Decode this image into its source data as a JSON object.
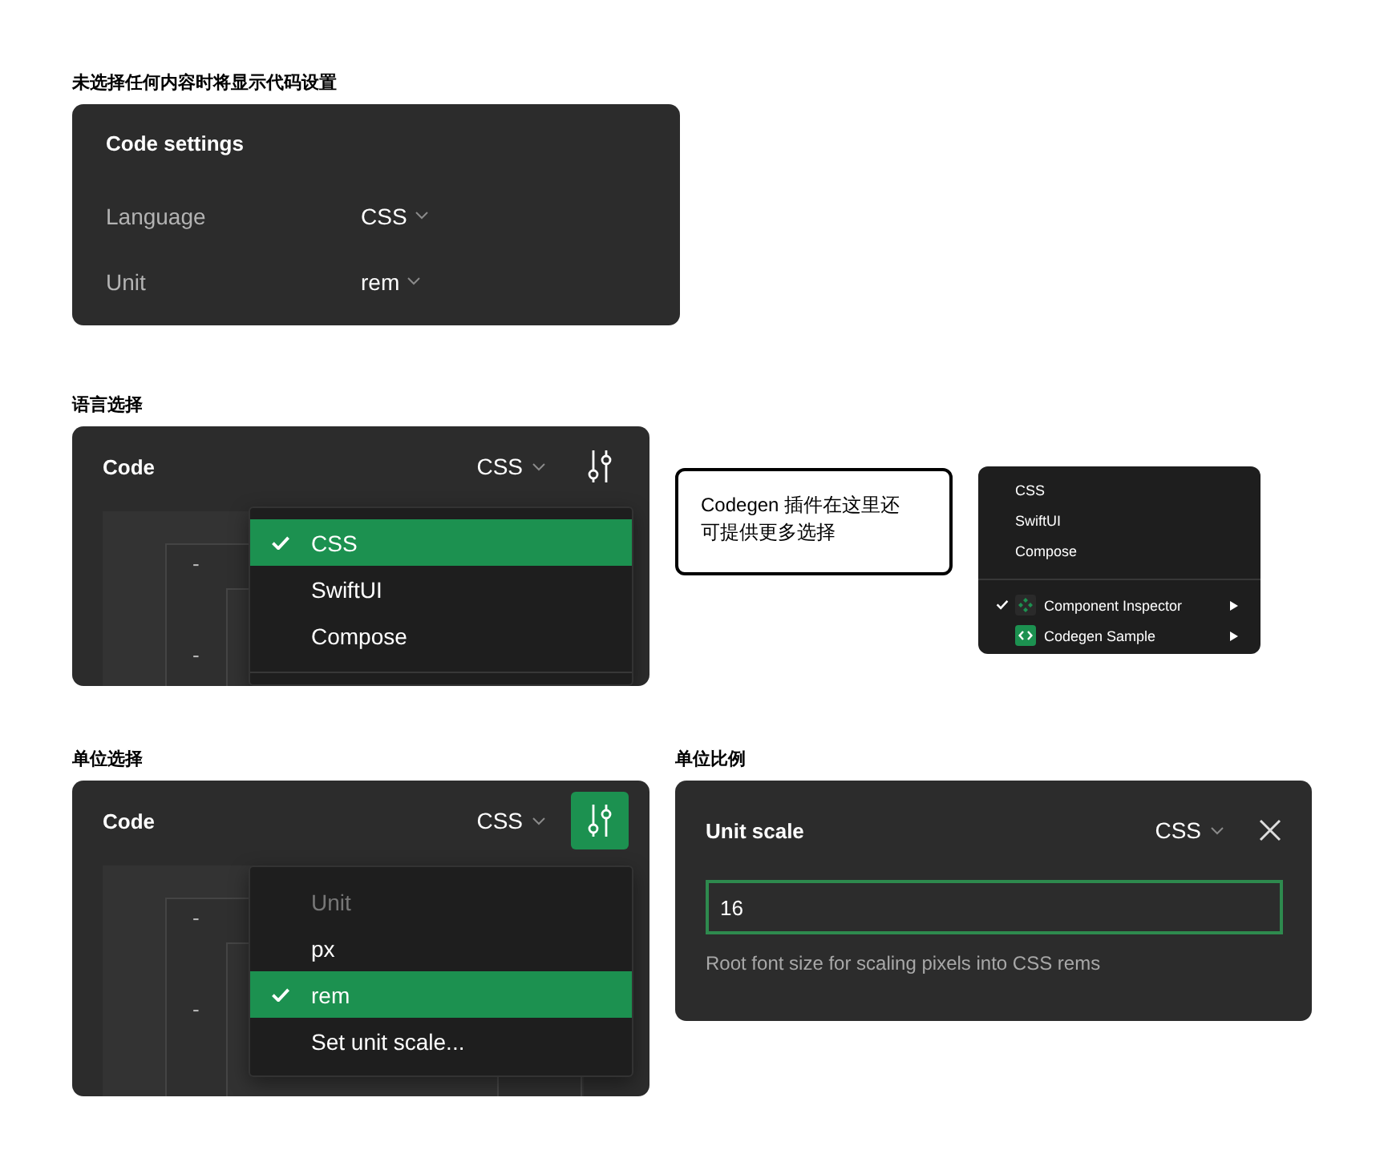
{
  "empty_state": {
    "caption": "未选择任何内容时将显示代码设置",
    "title": "Code settings",
    "rows": [
      {
        "label": "Language",
        "value": "CSS"
      },
      {
        "label": "Unit",
        "value": "rem"
      }
    ]
  },
  "language_picker": {
    "caption": "语言选择",
    "title": "Code",
    "language": "CSS",
    "settings_active": false,
    "code_markers": [
      "-",
      "-"
    ],
    "menu": [
      {
        "label": "CSS",
        "selected": true
      },
      {
        "label": "SwiftUI",
        "selected": false
      },
      {
        "label": "Compose",
        "selected": false
      }
    ]
  },
  "callout": {
    "text": "Codegen 插件在这里还可提供更多选择"
  },
  "plugin_menu": {
    "items": [
      {
        "kind": "language",
        "label": "CSS",
        "selected": false
      },
      {
        "kind": "language",
        "label": "SwiftUI",
        "selected": false
      },
      {
        "kind": "language",
        "label": "Compose",
        "selected": false
      },
      {
        "kind": "plugin",
        "label": "Component Inspector",
        "selected": true
      },
      {
        "kind": "plugin",
        "label": "Codegen Sample",
        "selected": false
      }
    ]
  },
  "unit_picker": {
    "caption": "单位选择",
    "title": "Code",
    "language": "CSS",
    "settings_active": true,
    "code_markers": [
      "-",
      "-"
    ],
    "menu_heading": "Unit",
    "menu": [
      {
        "label": "px",
        "selected": false
      },
      {
        "label": "rem",
        "selected": true
      },
      {
        "label": "Set unit scale...",
        "selected": false
      }
    ]
  },
  "unit_scale": {
    "caption": "单位比例",
    "title": "Unit scale",
    "language": "CSS",
    "value": "16",
    "help": "Root font size for scaling pixels into CSS rems"
  }
}
